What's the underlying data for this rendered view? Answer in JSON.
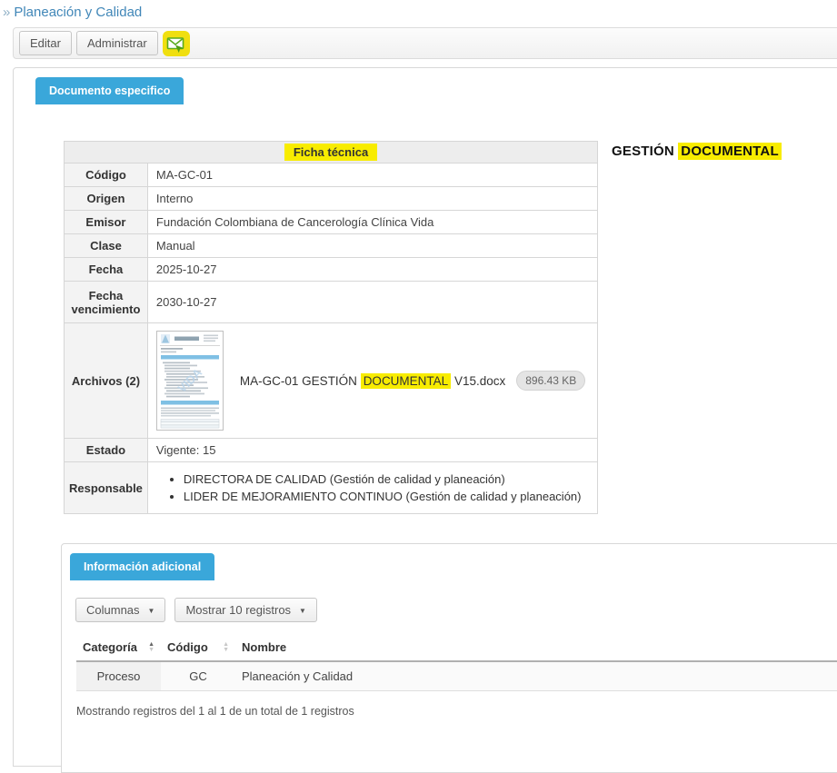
{
  "breadcrumb": {
    "chevron": "»",
    "label": "Planeación y Calidad"
  },
  "toolbar": {
    "edit_label": "Editar",
    "administer_label": "Administrar",
    "mail_icon": "send-mail-icon"
  },
  "tabs": {
    "documento": "Documento especifico",
    "informacion_adicional": "Información adicional"
  },
  "doc_heading": {
    "prefix": "GESTIÓN ",
    "highlight": "DOCUMENTAL"
  },
  "ficha": {
    "title": "Ficha técnica",
    "rows": [
      {
        "label": "Código",
        "value": "MA-GC-01"
      },
      {
        "label": "Origen",
        "value": "Interno"
      },
      {
        "label": "Emisor",
        "value": "Fundación Colombiana de Cancerología Clínica Vida"
      },
      {
        "label": "Clase",
        "value": "Manual"
      },
      {
        "label": "Fecha",
        "value": "2025-10-27"
      },
      {
        "label": "Fecha vencimiento",
        "value": "2030-10-27"
      }
    ],
    "archivos": {
      "label": "Archivos (2)",
      "file_prefix": "MA-GC-01 GESTIÓN ",
      "file_highlight": "DOCUMENTAL",
      "file_suffix": " V15.docx",
      "file_size": "896.43 KB",
      "thumbnail_icon": "docx-preview-thumbnail"
    },
    "estado": {
      "label": "Estado",
      "value": "Vigente: 15"
    },
    "responsable": {
      "label": "Responsable",
      "items": [
        "DIRECTORA DE CALIDAD (Gestión de calidad y planeación)",
        "LIDER DE MEJORAMIENTO CONTINUO (Gestión de calidad y planeación)"
      ]
    }
  },
  "info_adicional": {
    "columns_button": {
      "label": "Columnas",
      "caret": "▼"
    },
    "records_button": {
      "label": "Mostrar 10 registros",
      "caret": "▼"
    },
    "table": {
      "headers": [
        {
          "label": "Categoría",
          "sort": "asc"
        },
        {
          "label": "Código",
          "sort": "none"
        },
        {
          "label": "Nombre",
          "sort": "hidden"
        }
      ],
      "row": [
        "Proceso",
        "GC",
        "Planeación y Calidad"
      ]
    },
    "footer": "Mostrando registros del 1 al 1 de un total de 1 registros"
  },
  "icons": {
    "sort_asc": "▲",
    "sort_desc": "▼"
  },
  "colors": {
    "tab_blue": "#3aa7da",
    "link_blue": "#4187b8",
    "highlight_yellow": "#f8ec00",
    "icon_green": "#5aab1e"
  }
}
